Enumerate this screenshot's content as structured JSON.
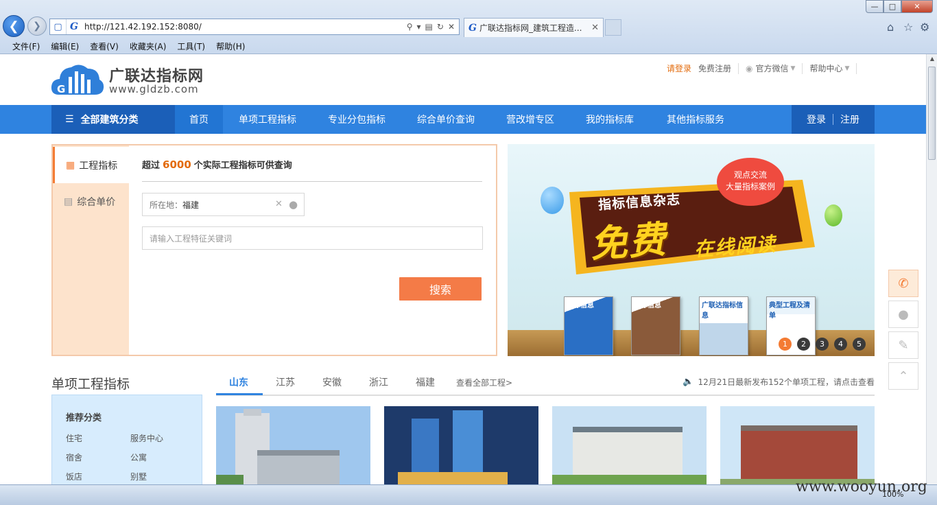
{
  "browser": {
    "url": "http://121.42.192.152:8080/",
    "tab_title": "广联达指标网_建筑工程造...",
    "menu": [
      "文件(F)",
      "编辑(E)",
      "查看(V)",
      "收藏夹(A)",
      "工具(T)",
      "帮助(H)"
    ],
    "zoom": "100%"
  },
  "header": {
    "site_name": "广联达指标网",
    "site_domain": "www.gldzb.com",
    "login": "请登录",
    "register": "免费注册",
    "wechat": "官方微信",
    "help": "帮助中心"
  },
  "nav": {
    "all_categories": "全部建筑分类",
    "items": [
      "首页",
      "单项工程指标",
      "专业分包指标",
      "综合单价查询",
      "营改增专区",
      "我的指标库",
      "其他指标服务"
    ],
    "active_index": 0,
    "login": "登录",
    "register": "注册"
  },
  "search": {
    "tabs": [
      "工程指标",
      "综合单价"
    ],
    "stat_prefix": "超过",
    "stat_number": "6000",
    "stat_suffix": "个实际工程指标可供查询",
    "location_label": "所在地：",
    "location_value": "福建",
    "keyword_placeholder": "请输入工程特征关键词",
    "button": "搜索"
  },
  "banner": {
    "bubble_line1": "观点交流",
    "bubble_line2": "大量指标案例",
    "magazine": "指标信息杂志",
    "free": "免费",
    "online": "在线阅读",
    "book1": "指标信息",
    "book2": "指标信息",
    "book3": "广联达指标信息",
    "book4": "典型工程及清单",
    "dots": [
      "1",
      "2",
      "3",
      "4",
      "5"
    ],
    "active_dot": 0
  },
  "section": {
    "title": "单项工程指标",
    "regions": [
      "山东",
      "江苏",
      "安徽",
      "浙江",
      "福建"
    ],
    "active_region": 0,
    "more": "查看全部工程>",
    "notice": "12月21日最新发布152个单项工程，请点击查看"
  },
  "recommend": {
    "title": "推荐分类",
    "items": [
      "住宅",
      "服务中心",
      "宿舍",
      "公寓",
      "饭店",
      "别墅"
    ]
  },
  "watermark": "www.wooyun.org",
  "colors": {
    "nav_blue": "#2f83e0",
    "nav_dark": "#1b5fb8",
    "accent_orange": "#f47b33",
    "search_button": "#f47b47"
  }
}
